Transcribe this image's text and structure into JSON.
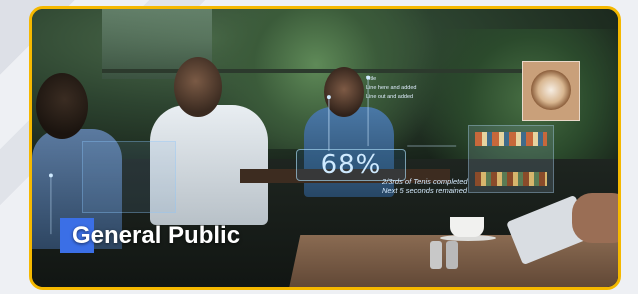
{
  "title": "General Public",
  "overlay": {
    "stat_value": "68%",
    "caption_lines": [
      "2/3rds of Tenis completed",
      "Next 5 seconds remained"
    ],
    "bullet_lines": [
      "Title",
      "Line here and added",
      "Line out and added"
    ]
  },
  "colors": {
    "border": "#f5b800",
    "label_accent": "#3b6fe6",
    "label_text": "#ffffff",
    "ar_text": "#cfeaff"
  }
}
